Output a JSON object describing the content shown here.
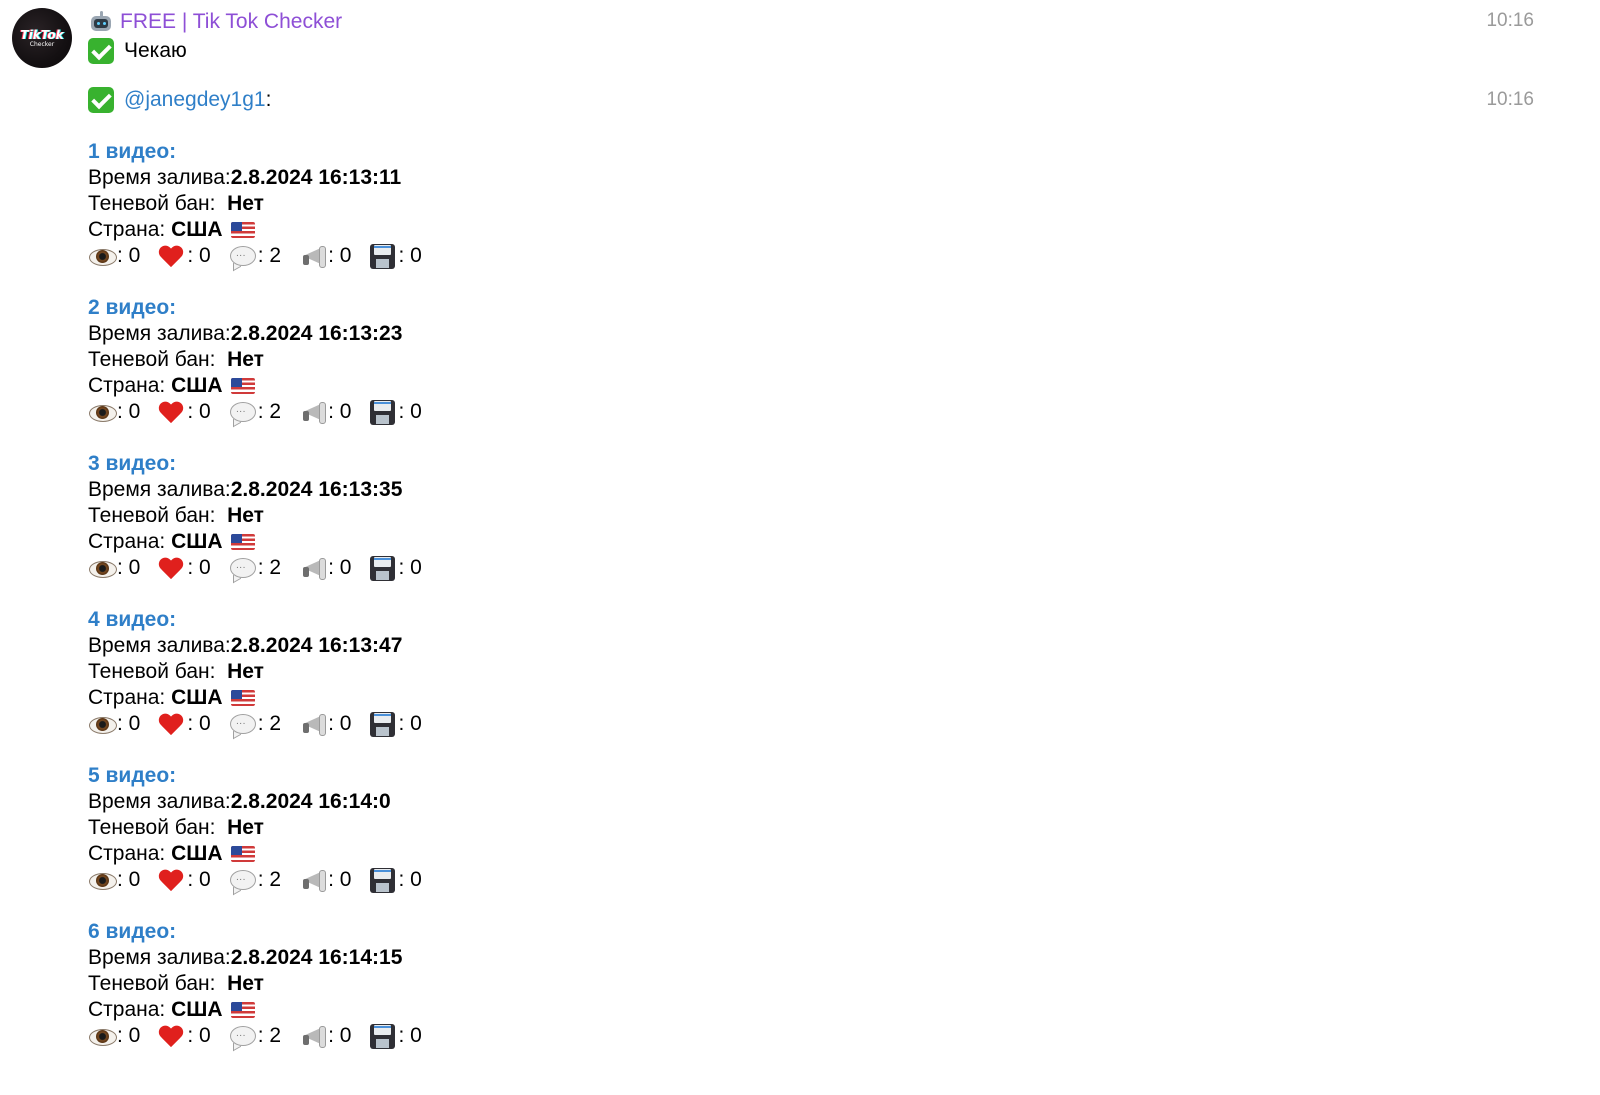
{
  "bot": {
    "avatar_text": "TikTok",
    "avatar_subtext": "Checker",
    "name": "FREE | Tik Tok Checker",
    "robot_icon": "robot-icon"
  },
  "message1": {
    "text": "Чекаю",
    "time": "10:16",
    "icon": "check-mark-button-icon"
  },
  "message2": {
    "mention": "@janegdey1g1",
    "mention_suffix": ":",
    "time": "10:16",
    "icon": "check-mark-button-icon"
  },
  "labels": {
    "upload_time": "Время залива: ",
    "shadow_ban": "Теневой бан:  ",
    "country": "Страна: "
  },
  "videos": [
    {
      "title": "1 видео:",
      "upload_time": "2.8.2024 16:13:11",
      "shadow_ban": "Нет",
      "country": "США",
      "views": "0",
      "likes": "0",
      "comments": "2",
      "shares": "0",
      "saves": "0"
    },
    {
      "title": "2 видео:",
      "upload_time": "2.8.2024 16:13:23",
      "shadow_ban": "Нет",
      "country": "США",
      "views": "0",
      "likes": "0",
      "comments": "2",
      "shares": "0",
      "saves": "0"
    },
    {
      "title": "3 видео:",
      "upload_time": "2.8.2024 16:13:35",
      "shadow_ban": "Нет",
      "country": "США",
      "views": "0",
      "likes": "0",
      "comments": "2",
      "shares": "0",
      "saves": "0"
    },
    {
      "title": "4 видео:",
      "upload_time": "2.8.2024 16:13:47",
      "shadow_ban": "Нет",
      "country": "США",
      "views": "0",
      "likes": "0",
      "comments": "2",
      "shares": "0",
      "saves": "0"
    },
    {
      "title": "5 видео:",
      "upload_time": "2.8.2024 16:14:0",
      "shadow_ban": "Нет",
      "country": "США",
      "views": "0",
      "likes": "0",
      "comments": "2",
      "shares": "0",
      "saves": "0"
    },
    {
      "title": "6 видео:",
      "upload_time": "2.8.2024 16:14:15",
      "shadow_ban": "Нет",
      "country": "США",
      "views": "0",
      "likes": "0",
      "comments": "2",
      "shares": "0",
      "saves": "0"
    }
  ],
  "colors": {
    "sender_name": "#8e4fd6",
    "link": "#2f7fc8",
    "timestamp": "#9a9a9a",
    "check_green": "#38b22f"
  }
}
